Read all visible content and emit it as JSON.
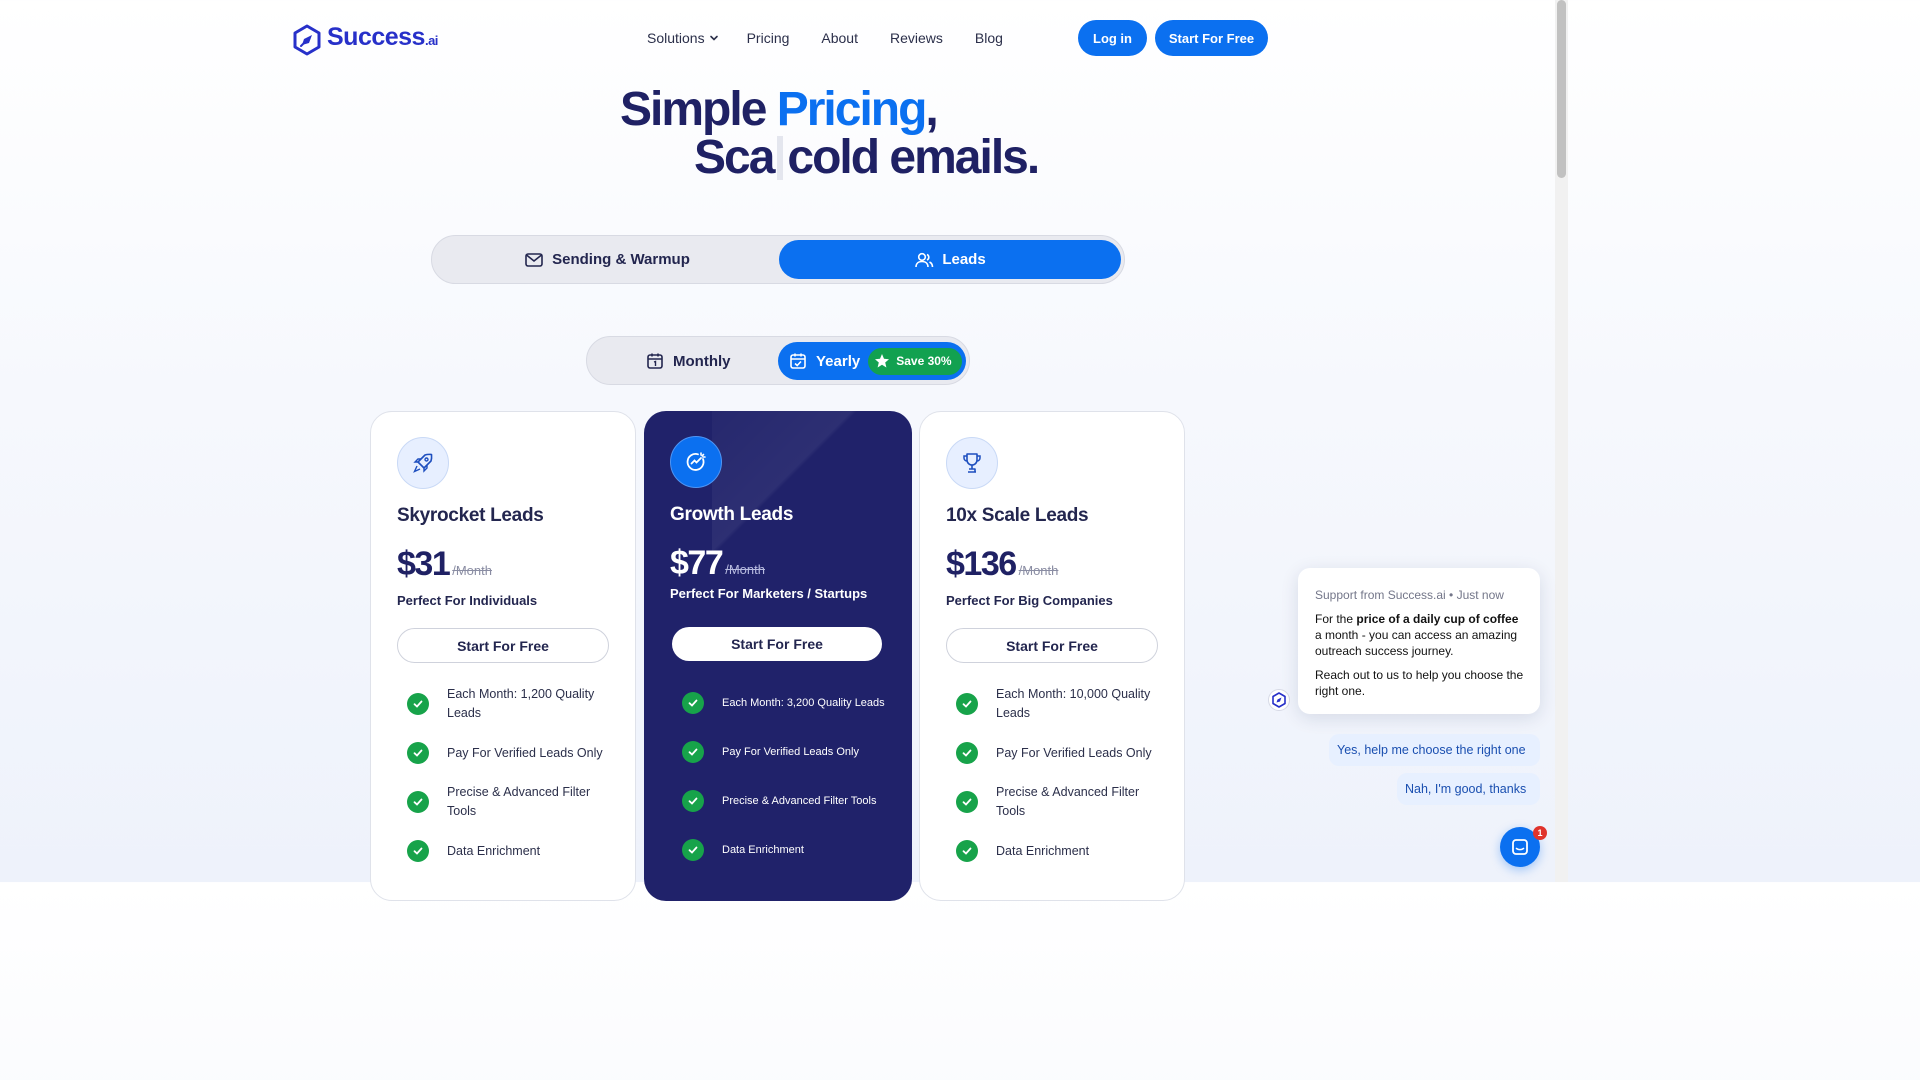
{
  "brand": {
    "name": "Success",
    "suffix": ".ai",
    "color": "#2730c9"
  },
  "nav": {
    "solutions": "Solutions",
    "pricing": "Pricing",
    "about": "About",
    "reviews": "Reviews",
    "blog": "Blog"
  },
  "header": {
    "login": "Log in",
    "start": "Start For Free"
  },
  "hero": {
    "line1_a": "Simple ",
    "line1_accent": "Pricing",
    "line1_b": ",",
    "line2_a": "Sca",
    "line2_b": "cold emails."
  },
  "product_toggle": {
    "options": [
      {
        "label": "Sending & Warmup",
        "icon": "mail-icon",
        "selected": false
      },
      {
        "label": "Leads",
        "icon": "users-icon",
        "selected": true
      }
    ]
  },
  "billing_toggle": {
    "monthly": "Monthly",
    "yearly": "Yearly",
    "save": "Save 30%",
    "selected": "yearly"
  },
  "plans": [
    {
      "name": "Skyrocket Leads",
      "icon": "rocket-icon",
      "price": "$31",
      "per": "/Month",
      "desc": "Perfect For Individuals",
      "cta": "Start For Free",
      "features": [
        "Each Month: 1,200 Quality Leads",
        "Pay For Verified Leads Only",
        "Precise & Advanced Filter Tools",
        "Data Enrichment"
      ]
    },
    {
      "name": "Growth Leads",
      "icon": "growth-icon",
      "price": "$77",
      "per": "/Month",
      "desc": "Perfect For Marketers / Startups",
      "cta": "Start For Free",
      "features": [
        "Each Month: 3,200 Quality Leads",
        "Pay For Verified Leads Only",
        "Precise & Advanced Filter Tools",
        "Data Enrichment"
      ]
    },
    {
      "name": "10x Scale Leads",
      "icon": "trophy-icon",
      "price": "$136",
      "per": "/Month",
      "desc": "Perfect For Big Companies",
      "cta": "Start For Free",
      "features": [
        "Each Month: 10,000 Quality Leads",
        "Pay For Verified Leads Only",
        "Precise & Advanced Filter Tools",
        "Data Enrichment"
      ]
    }
  ],
  "chat": {
    "meta": "Support from Success.ai • Just now",
    "msg1_a": "For the ",
    "msg1_bold": "price of a daily cup of coffee",
    "msg1_b": " a month - you can access an amazing outreach success journey.",
    "msg2": "Reach out to us to help you choose the right one.",
    "reply1": "Yes, help me choose the right one",
    "reply2": "Nah, I'm good, thanks",
    "badge_count": "1"
  },
  "colors": {
    "primary": "#0b70f0",
    "dark_card": "#20226a",
    "check": "#17a34a",
    "save_badge": "#12a150"
  }
}
